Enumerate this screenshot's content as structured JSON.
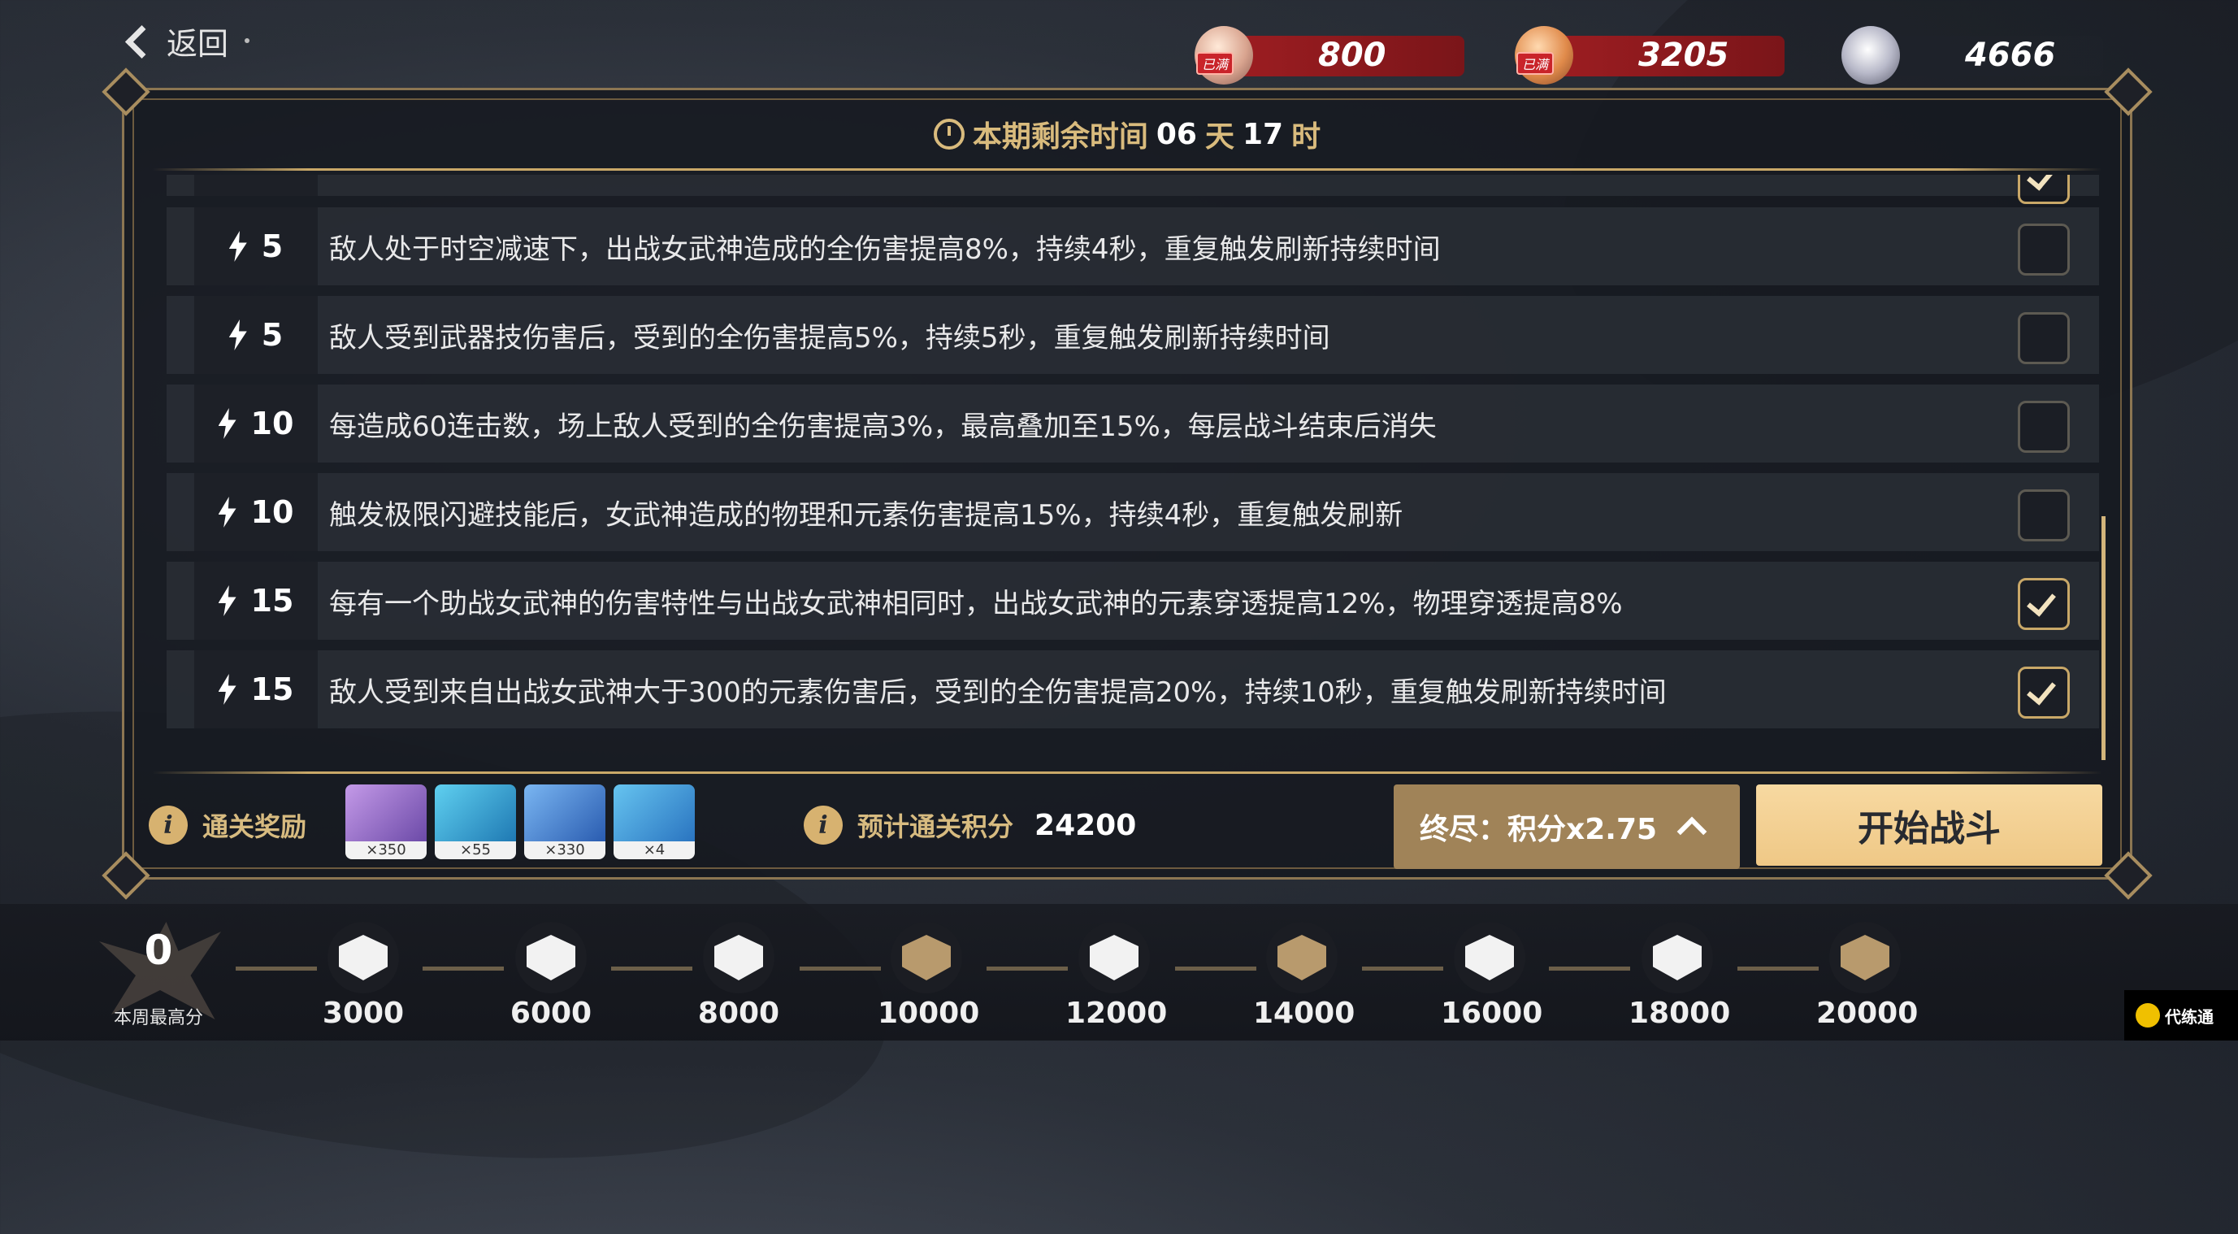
{
  "nav": {
    "back_label": "返回"
  },
  "currencies": [
    {
      "icon": "crystal-icon",
      "tag": "已满",
      "amount": "800"
    },
    {
      "icon": "coin-icon",
      "tag": "已满",
      "amount": "3205"
    },
    {
      "icon": "emblem-currency-icon",
      "amount": "4666"
    }
  ],
  "timer": {
    "prefix": "本期剩余时间",
    "days": "06",
    "days_unit": "天",
    "hours": "17",
    "hours_unit": "时"
  },
  "buffs": [
    {
      "cost": "5",
      "desc": "敌人处于时空减速下，出战女武神造成的全伤害提高8%，持续4秒，重复触发刷新持续时间",
      "checked": false
    },
    {
      "cost": "5",
      "desc": "敌人受到武器技伤害后，受到的全伤害提高5%，持续5秒，重复触发刷新持续时间",
      "checked": false
    },
    {
      "cost": "10",
      "desc": "每造成60连击数，场上敌人受到的全伤害提高3%，最高叠加至15%，每层战斗结束后消失",
      "checked": false
    },
    {
      "cost": "10",
      "desc": "触发极限闪避技能后，女武神造成的物理和元素伤害提高15%，持续4秒，重复触发刷新",
      "checked": false
    },
    {
      "cost": "15",
      "desc": "每有一个助战女武神的伤害特性与出战女武神相同时，出战女武神的元素穿透提高12%，物理穿透提高8%",
      "checked": true
    },
    {
      "cost": "15",
      "desc": "敌人受到来自出战女武神大于300的元素伤害后，受到的全伤害提高20%，持续10秒，重复触发刷新持续时间",
      "checked": true
    }
  ],
  "rewards": {
    "label": "通关奖励",
    "items": [
      {
        "icon": "valkyrie-fragment-icon",
        "qty": "×350",
        "color": "#a67cd6"
      },
      {
        "icon": "green-coin-icon",
        "qty": "×55",
        "color": "#37a8d8"
      },
      {
        "icon": "blue-crystal-icon",
        "qty": "×330",
        "color": "#3f84d6"
      },
      {
        "icon": "flower-icon",
        "qty": "×4",
        "color": "#3b98d8"
      }
    ]
  },
  "score": {
    "label": "预计通关积分",
    "value": "24200"
  },
  "difficulty": {
    "label": "终尽：积分x2.75"
  },
  "start": {
    "label": "开始战斗"
  },
  "weekly": {
    "best_value": "0",
    "best_label": "本周最高分",
    "milestones": [
      {
        "value": "3000",
        "state": "silver"
      },
      {
        "value": "6000",
        "state": "silver"
      },
      {
        "value": "8000",
        "state": "silver"
      },
      {
        "value": "10000",
        "state": "gold"
      },
      {
        "value": "12000",
        "state": "silver"
      },
      {
        "value": "14000",
        "state": "gold"
      },
      {
        "value": "16000",
        "state": "silver"
      },
      {
        "value": "18000",
        "state": "silver"
      },
      {
        "value": "20000",
        "state": "gold"
      }
    ]
  },
  "watermark": {
    "text": "代练通"
  }
}
